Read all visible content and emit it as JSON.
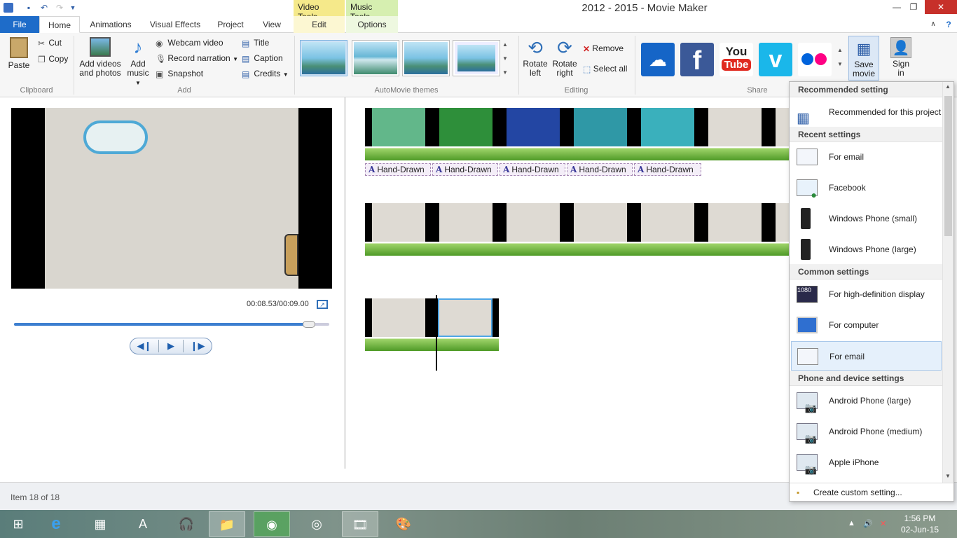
{
  "window": {
    "title": "2012 - 2015 - Movie Maker",
    "context_tabs": [
      "Video Tools",
      "Music Tools"
    ]
  },
  "tabs": [
    "File",
    "Home",
    "Animations",
    "Visual Effects",
    "Project",
    "View",
    "Edit",
    "Options"
  ],
  "ribbon": {
    "clipboard": {
      "paste": "Paste",
      "cut": "Cut",
      "copy": "Copy",
      "label": "Clipboard"
    },
    "add": {
      "add_videos": "Add videos",
      "add_videos_2": "and photos",
      "add_music": "Add",
      "add_music_2": "music",
      "webcam": "Webcam video",
      "narration": "Record narration",
      "snapshot": "Snapshot",
      "title": "Title",
      "caption": "Caption",
      "credits": "Credits",
      "label": "Add"
    },
    "themes": {
      "label": "AutoMovie themes"
    },
    "editing": {
      "rotate_left": "Rotate",
      "rotate_left_2": "left",
      "rotate_right": "Rotate",
      "rotate_right_2": "right",
      "remove": "Remove",
      "select_all": "Select all",
      "label": "Editing"
    },
    "share": {
      "label": "Share",
      "save_movie": "Save",
      "save_movie_2": "movie",
      "sign_in": "Sign",
      "sign_in_2": "in",
      "youtube_1": "You",
      "youtube_2": "Tube"
    }
  },
  "preview": {
    "timecode": "00:08.53/00:09.00",
    "progress_fraction": 0.948
  },
  "timeline": {
    "caption_chips": [
      "Hand-Drawn",
      "Hand-Drawn",
      "Hand-Drawn",
      "Hand-Drawn",
      "Hand-Drawn"
    ]
  },
  "status": {
    "item_text": "Item 18 of 18"
  },
  "menu": {
    "sections": [
      {
        "header": "Recommended setting",
        "items": [
          {
            "label": "Recommended for this project",
            "icon": "recommended-icon"
          }
        ]
      },
      {
        "header": "Recent settings",
        "items": [
          {
            "label": "For email",
            "icon": "email-icon"
          },
          {
            "label": "Facebook",
            "icon": "facebook-globe-icon"
          },
          {
            "label": "Windows Phone (small)",
            "icon": "windows-phone-icon"
          },
          {
            "label": "Windows Phone (large)",
            "icon": "windows-phone-icon"
          }
        ]
      },
      {
        "header": "Common settings",
        "items": [
          {
            "label": "For high-definition display",
            "icon": "hd-display-icon"
          },
          {
            "label": "For computer",
            "icon": "computer-icon"
          },
          {
            "label": "For email",
            "icon": "email-icon"
          }
        ]
      },
      {
        "header": "Phone and device settings",
        "items": [
          {
            "label": "Android Phone (large)",
            "icon": "android-phone-icon"
          },
          {
            "label": "Android Phone (medium)",
            "icon": "android-phone-icon"
          },
          {
            "label": "Apple iPhone",
            "icon": "iphone-icon"
          }
        ]
      }
    ],
    "hd_badge": "1080",
    "footer": "Create custom setting..."
  },
  "taskbar": {
    "time": "1:56 PM",
    "date": "02-Jun-15"
  },
  "colors": {
    "accent": "#1e6cc9",
    "context_video": "#f5e98a",
    "context_music": "#d6efb0",
    "close": "#c7302a"
  }
}
